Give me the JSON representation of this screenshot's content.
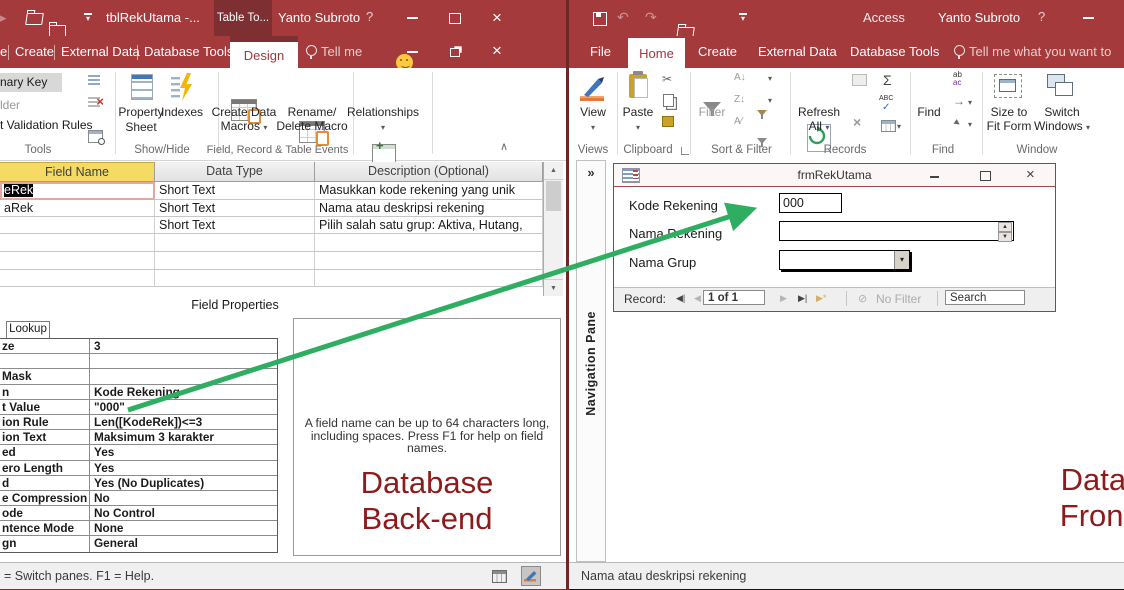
{
  "glyphs": {
    "dropdown": "▾",
    "collapse": "∧",
    "close": "×",
    "undo": "↶",
    "redo": "↷",
    "scissors": "✂",
    "sigma": "Σ",
    "check": "✓",
    "chevrons_right": "»",
    "nav_first": "◀|",
    "nav_prev": "◀",
    "nav_next": "▶",
    "nav_last": "▶|",
    "nav_new": "▶*",
    "spin_up": "▲",
    "spin_down": "▼",
    "sort_az": "A↓",
    "sort_za": "Z↓",
    "sort_clear": "A⁄",
    "goto_arrow": "→",
    "select_cursor": "▸",
    "replace_top": "ab",
    "replace_bottom": "ac",
    "abc": "ABC",
    "filter_off": "⊘"
  },
  "left": {
    "titlebar": {
      "title": "tblRekUtama  -...",
      "ctx_tab": "Table To...",
      "user": "Yanto Subroto",
      "help": "?"
    },
    "tabs": {
      "cut": "e",
      "create": "Create",
      "external": "External Data",
      "dbtools": "Database Tools",
      "active": "Design",
      "tellme": "Tell me"
    },
    "ribbon": {
      "primary_key": "nary Key",
      "builder": "lder",
      "validation": "t Validation Rules",
      "grp_tools": "Tools",
      "property_sheet": "Property Sheet",
      "indexes": "Indexes",
      "grp_showhide": "Show/Hide",
      "macros_l1": "Create Data",
      "macros_l2": "Macros",
      "rename_l1": "Rename/",
      "rename_l2": "Delete Macro",
      "grp_events": "Field, Record & Table Events",
      "relationships": "Relationships"
    },
    "grid": {
      "h_field": "Field Name",
      "h_type": "Data Type",
      "h_desc": "Description (Optional)",
      "rows": [
        {
          "name": "eRek",
          "type": "Short Text",
          "desc": "Masukkan kode rekening yang unik"
        },
        {
          "name": "aRek",
          "type": "Short Text",
          "desc": "Nama atau deskripsi rekening"
        },
        {
          "name": "",
          "type": "Short Text",
          "desc": "Pilih salah satu grup: Aktiva, Hutang,"
        }
      ],
      "footer": "Field Properties"
    },
    "props": {
      "tab": "Lookup",
      "rows": [
        {
          "label": "ze",
          "value": "3"
        },
        {
          "label": "",
          "value": ""
        },
        {
          "label": "Mask",
          "value": ""
        },
        {
          "label": "n",
          "value": "Kode Rekening"
        },
        {
          "label": "t Value",
          "value": "\"000\""
        },
        {
          "label": "ion Rule",
          "value": "Len([KodeRek])<=3"
        },
        {
          "label": "ion Text",
          "value": "Maksimum 3 karakter"
        },
        {
          "label": "ed",
          "value": "Yes"
        },
        {
          "label": "ero Length",
          "value": "Yes"
        },
        {
          "label": "d",
          "value": "Yes (No Duplicates)"
        },
        {
          "label": "e Compression",
          "value": "No"
        },
        {
          "label": "ode",
          "value": "No Control"
        },
        {
          "label": "ntence Mode",
          "value": "None"
        },
        {
          "label": "gn",
          "value": "General"
        }
      ]
    },
    "help_text": "A field name can be up to 64 characters long, including spaces. Press F1 for help on field names.",
    "caption_l1": "Database",
    "caption_l2": "Back-end",
    "status": "= Switch panes.  F1 = Help."
  },
  "right": {
    "titlebar": {
      "app": "Access",
      "user": "Yanto Subroto",
      "help": "?"
    },
    "tabs": {
      "file": "File",
      "home": "Home",
      "create": "Create",
      "external": "External Data",
      "dbtools": "Database Tools",
      "tellme": "Tell me what you want to"
    },
    "ribbon": {
      "view": "View",
      "grp_views": "Views",
      "paste": "Paste",
      "grp_clipboard": "Clipboard",
      "filter": "Filter",
      "grp_sort": "Sort & Filter",
      "refresh_l1": "Refresh",
      "refresh_l2": "All",
      "grp_records": "Records",
      "find": "Find",
      "grp_find": "Find",
      "sizefit_l1": "Size to",
      "sizefit_l2": "Fit Form",
      "switch_l1": "Switch",
      "switch_l2": "Windows",
      "grp_window": "Window"
    },
    "nav_pane": "Navigation Pane",
    "form": {
      "title": "frmRekUtama",
      "label_kode": "Kode Rekening",
      "value_kode": "000",
      "label_nama": "Nama Rekening",
      "label_grup": "Nama Grup",
      "record_label": "Record:",
      "record_pos": "1 of 1",
      "no_filter": "No Filter",
      "search": "Search"
    },
    "caption_l1": "Database",
    "caption_l2": "Front-end",
    "status": "Nama atau deskripsi rekening"
  },
  "colors": {
    "titlebar_red": "#A43A3C",
    "contextual_tab_red": "#7E2F31",
    "accent_red": "#A4373A",
    "caption_red": "#8E1B1B",
    "arrow_green": "#2FAE62",
    "field_header_yellow": "#F5DB63"
  }
}
